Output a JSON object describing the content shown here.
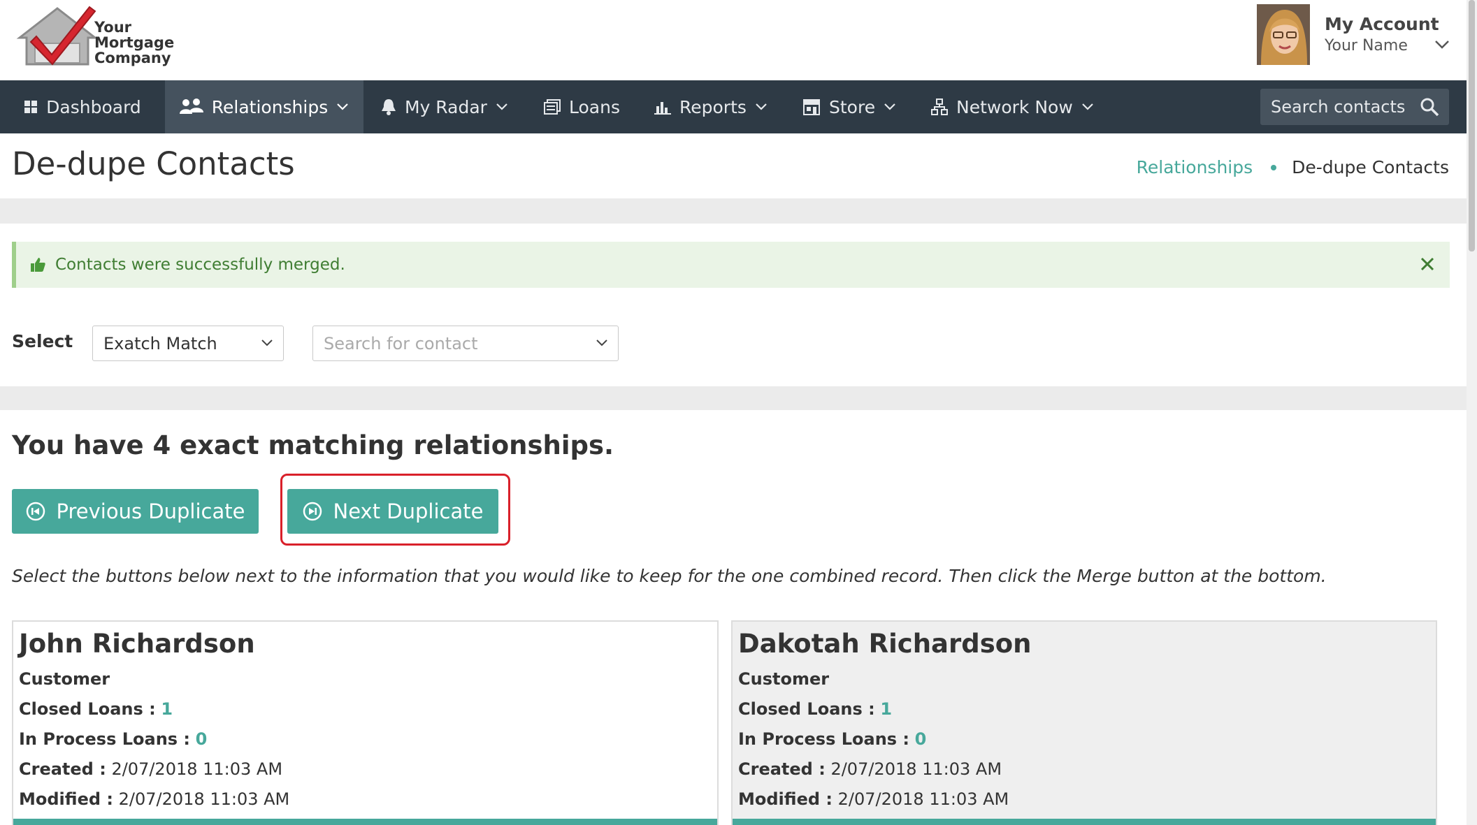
{
  "header": {
    "logo_lines": [
      "Your",
      "Mortgage",
      "Company"
    ],
    "account_title": "My Account",
    "account_name": "Your Name"
  },
  "nav": {
    "items": [
      {
        "label": "Dashboard",
        "icon": "dashboard-icon"
      },
      {
        "label": "Relationships",
        "icon": "people-icon"
      },
      {
        "label": "My Radar",
        "icon": "bell-icon"
      },
      {
        "label": "Loans",
        "icon": "document-stack-icon"
      },
      {
        "label": "Reports",
        "icon": "bar-chart-icon"
      },
      {
        "label": "Store",
        "icon": "store-icon"
      },
      {
        "label": "Network Now",
        "icon": "network-icon"
      }
    ],
    "search_placeholder": "Search contacts"
  },
  "page": {
    "title": "De-dupe Contacts",
    "breadcrumb": [
      "Relationships",
      "De-dupe Contacts"
    ]
  },
  "alert": {
    "text": "Contacts were successfully merged."
  },
  "filters": {
    "label": "Select",
    "match_value": "Exatch Match",
    "contact_placeholder": "Search for contact"
  },
  "summary": {
    "heading": "You have 4 exact matching relationships.",
    "prev_label": "Previous Duplicate",
    "next_label": "Next Duplicate",
    "instructions": "Select the buttons below next to the information that you would like to keep for the one combined record. Then click the Merge button at the bottom."
  },
  "cards": [
    {
      "name": "John Richardson",
      "type": "Customer",
      "closed_label": "Closed Loans :",
      "closed_value": "1",
      "process_label": "In Process Loans :",
      "process_value": "0",
      "created_label": "Created :",
      "created_value": "2/07/2018 11:03 AM",
      "modified_label": "Modified :",
      "modified_value": "2/07/2018 11:03 AM"
    },
    {
      "name": "Dakotah Richardson",
      "type": "Customer",
      "closed_label": "Closed Loans :",
      "closed_value": "1",
      "process_label": "In Process Loans :",
      "process_value": "0",
      "created_label": "Created :",
      "created_value": "2/07/2018 11:03 AM",
      "modified_label": "Modified :",
      "modified_value": "2/07/2018 11:03 AM"
    }
  ],
  "colors": {
    "nav_bg": "#2e3a45",
    "accent": "#47a89b",
    "alert_bg": "#eaf4e6",
    "alert_text": "#3f7d32",
    "highlight": "#d9202a"
  }
}
